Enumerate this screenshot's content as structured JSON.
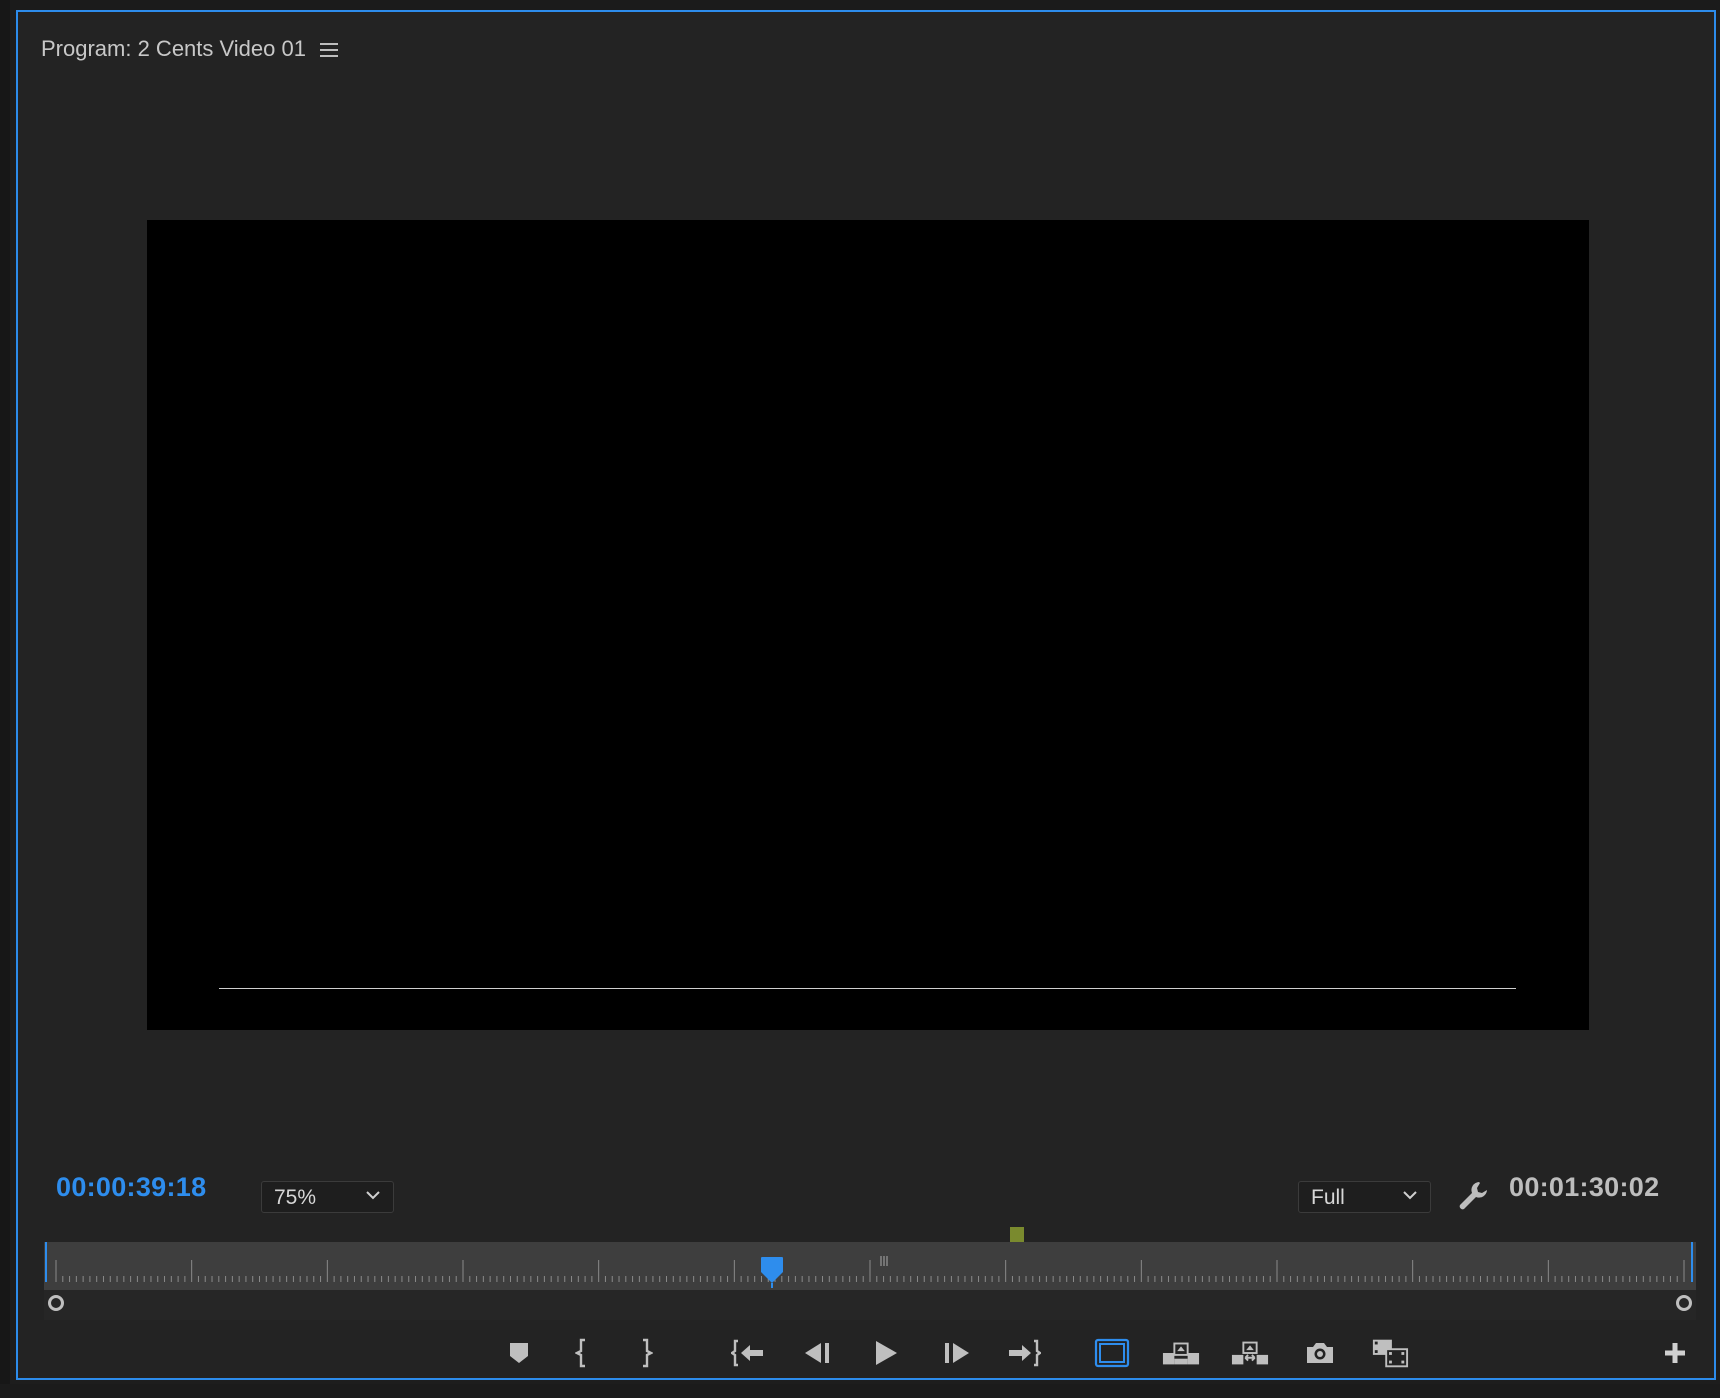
{
  "panel": {
    "title": "Program: 2 Cents Video 01",
    "menu_icon": "hamburger-menu-icon"
  },
  "timecodes": {
    "current": "00:00:39:18",
    "duration": "00:01:30:02"
  },
  "zoom": {
    "selected": "75%"
  },
  "quality": {
    "selected": "Full"
  },
  "timeline": {
    "playhead_position_fraction": 0.44,
    "marker_position_fraction": 0.59
  },
  "controls": [
    {
      "name": "add-marker-button",
      "icon": "marker-icon"
    },
    {
      "name": "mark-in-button",
      "icon": "mark-in-icon"
    },
    {
      "name": "mark-out-button",
      "icon": "mark-out-icon"
    },
    {
      "name": "go-to-in-button",
      "icon": "go-to-in-icon"
    },
    {
      "name": "step-back-button",
      "icon": "step-back-icon"
    },
    {
      "name": "play-button",
      "icon": "play-icon"
    },
    {
      "name": "step-forward-button",
      "icon": "step-forward-icon"
    },
    {
      "name": "go-to-out-button",
      "icon": "go-to-out-icon"
    },
    {
      "name": "safe-margins-button",
      "icon": "safe-margins-icon"
    },
    {
      "name": "lift-button",
      "icon": "lift-icon"
    },
    {
      "name": "extract-button",
      "icon": "extract-icon"
    },
    {
      "name": "export-frame-button",
      "icon": "camera-icon"
    },
    {
      "name": "comparison-view-button",
      "icon": "comparison-view-icon"
    },
    {
      "name": "button-editor-button",
      "icon": "plus-icon"
    }
  ],
  "colors": {
    "accent": "#2e8ded",
    "playhead": "#2e8ded",
    "marker": "#7a8a2e",
    "panel_border": "#2d8ceb"
  }
}
